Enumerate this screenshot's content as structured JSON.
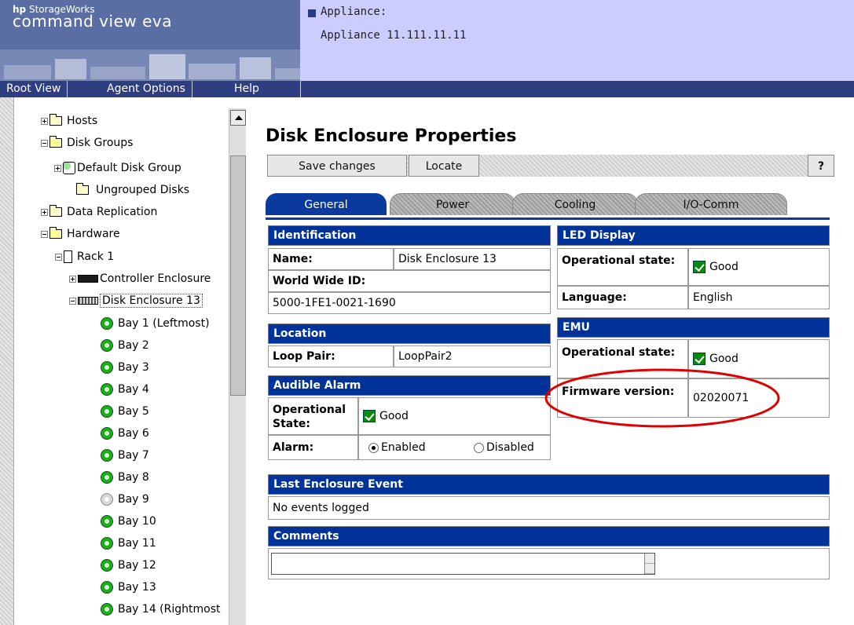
{
  "header": {
    "brand_hp": "hp",
    "brand_sw": "StorageWorks",
    "brand_product": "command view eva",
    "appliance_label": "Appliance:",
    "appliance_value": "Appliance 11.111.11.11"
  },
  "nav": [
    "Root View",
    "Agent Options",
    "Help"
  ],
  "tree": {
    "hosts": "Hosts",
    "disk_groups": "Disk Groups",
    "default_disk_group": "Default Disk Group",
    "ungrouped_disks": "Ungrouped Disks",
    "data_replication": "Data Replication",
    "hardware": "Hardware",
    "rack1": "Rack 1",
    "controller_enclosure": "Controller Enclosure",
    "disk_enclosure_13": "Disk Enclosure 13",
    "bays": [
      "Bay 1 (Leftmost)",
      "Bay 2",
      "Bay 3",
      "Bay 4",
      "Bay 5",
      "Bay 6",
      "Bay 7",
      "Bay 8",
      "Bay 9",
      "Bay 10",
      "Bay 11",
      "Bay 12",
      "Bay 13",
      "Bay 14 (Rightmost"
    ]
  },
  "page": {
    "title": "Disk Enclosure Properties",
    "buttons": {
      "save": "Save changes",
      "locate": "Locate",
      "help": "?"
    },
    "tabs": [
      "General",
      "Power",
      "Cooling",
      "I/O-Comm"
    ],
    "active_tab": "General"
  },
  "identification": {
    "header": "Identification",
    "name_label": "Name:",
    "name_value": "Disk Enclosure 13",
    "wwid_label": "World Wide ID:",
    "wwid_value": "5000-1FE1-0021-1690"
  },
  "location": {
    "header": "Location",
    "loop_pair_label": "Loop Pair:",
    "loop_pair_value": "LoopPair2"
  },
  "audible_alarm": {
    "header": "Audible Alarm",
    "state_label": "Operational State:",
    "state_value": "Good",
    "alarm_label": "Alarm:",
    "enabled": "Enabled",
    "disabled": "Disabled",
    "selected": "Enabled"
  },
  "led_display": {
    "header": "LED Display",
    "state_label": "Operational state:",
    "state_value": "Good",
    "language_label": "Language:",
    "language_value": "English"
  },
  "emu": {
    "header": "EMU",
    "state_label": "Operational state:",
    "state_value": "Good",
    "fw_label": "Firmware version:",
    "fw_value": "02020071"
  },
  "last_event": {
    "header": "Last Enclosure Event",
    "value": "No events logged"
  },
  "comments": {
    "header": "Comments",
    "value": ""
  },
  "colors": {
    "panel_header": "#003399",
    "top_bar": "#5a6ea3",
    "info_bar": "#ccccff",
    "nav_bar": "#2e3e80",
    "status_good": "#0a8a0a",
    "annotation": "#e00000"
  }
}
